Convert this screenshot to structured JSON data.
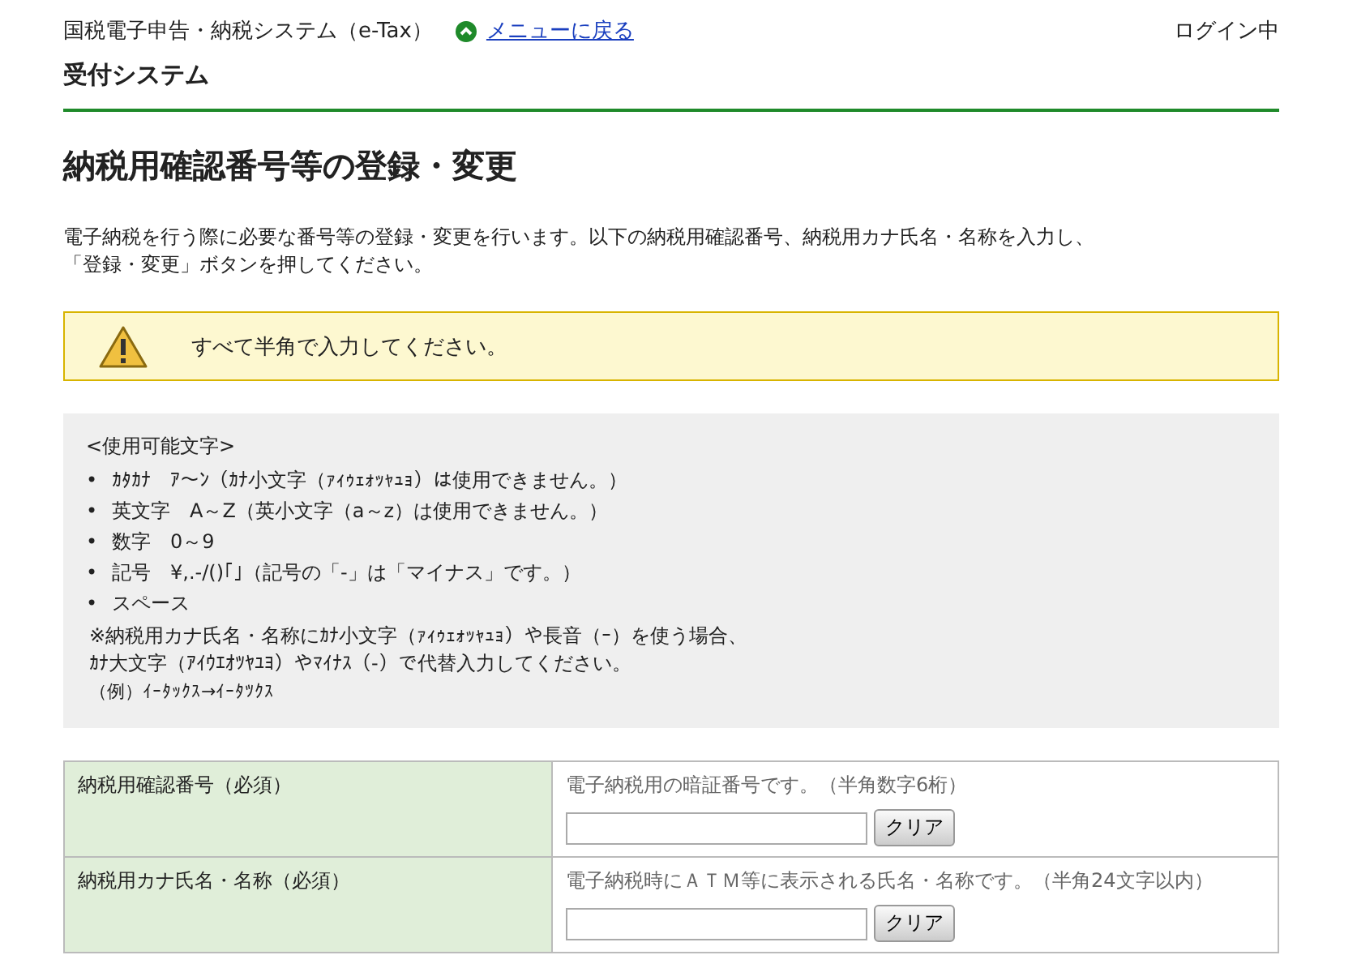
{
  "header": {
    "system_name": "国税電子申告・納税システム（e-Tax）",
    "menu_link": "メニューに戻る",
    "login_status": "ログイン中",
    "subsystem": "受付システム"
  },
  "page_title": "納税用確認番号等の登録・変更",
  "intro": [
    "電子納税を行う際に必要な番号等の登録・変更を行います。以下の納税用確認番号、納税用カナ氏名・名称を入力し、",
    "「登録・変更」ボタンを押してください。"
  ],
  "warning": "すべて半角で入力してください。",
  "allowed": {
    "heading": "<使用可能文字>",
    "items": [
      {
        "marker": "•",
        "text": "ｶﾀｶﾅ　ｱ～ﾝ（ｶﾅ小文字（ｧｨｩｪｫｯｬｭｮ）は使用できません。）"
      },
      {
        "marker": "•",
        "text": "英文字　A～Z（英小文字（a～z）は使用できません。）"
      },
      {
        "marker": "•",
        "text": "数字　0～9"
      },
      {
        "marker": "•",
        "text": "記号　¥,.-/()｢｣（記号の「-」は「マイナス」です。）"
      },
      {
        "marker": "•",
        "text": "スペース"
      }
    ],
    "note": [
      "※納税用カナ氏名・名称にｶﾅ小文字（ｧｨｩｪｫｯｬｭｮ）や長音（ｰ）を使う場合、",
      "ｶﾅ大文字（ｱｲｳｴｵﾂﾔﾕﾖ）やﾏｲﾅｽ（-）で代替入力してください。"
    ],
    "example": "（例）ｲｰﾀｯｸｽ→ｲｰﾀﾂｸｽ"
  },
  "form": [
    {
      "label": "納税用確認番号（必須）",
      "hint": "電子納税用の暗証番号です。（半角数字6桁）",
      "button": "クリア"
    },
    {
      "label": "納税用カナ氏名・名称（必須）",
      "hint": "電子納税時にＡＴＭ等に表示される氏名・名称です。（半角24文字以内）",
      "button": "クリア"
    }
  ]
}
